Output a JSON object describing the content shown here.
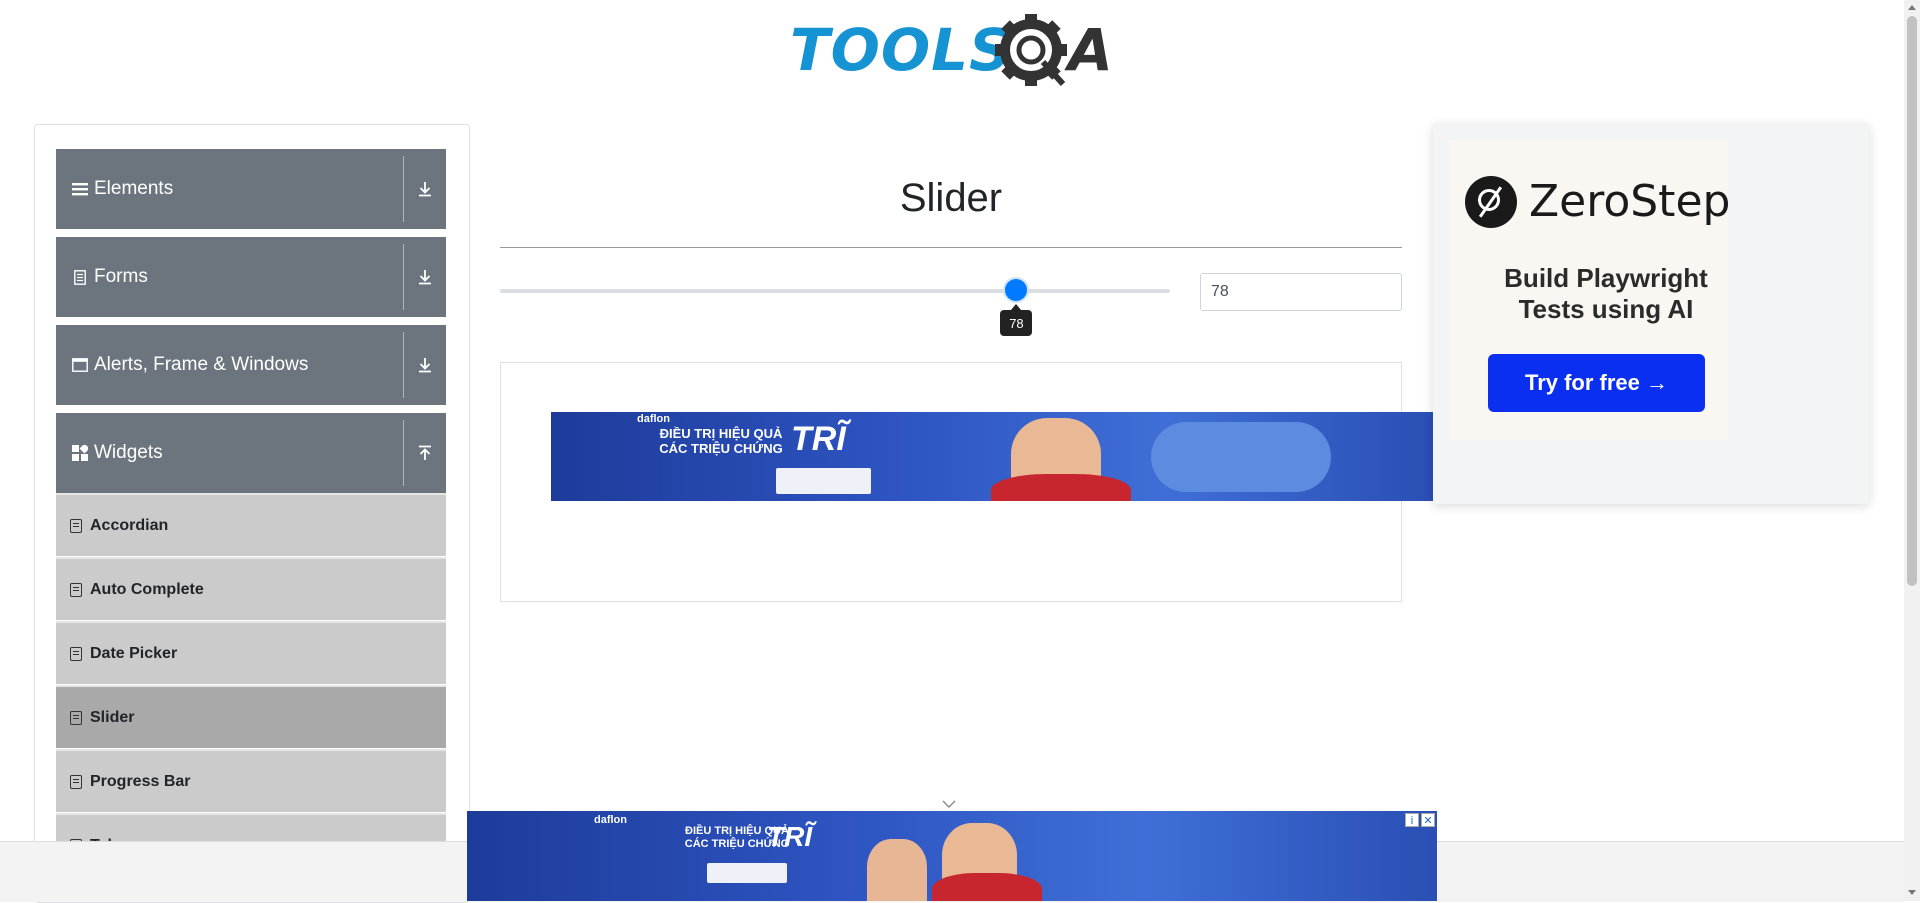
{
  "header": {
    "logo_text": "TOOLS",
    "logo_suffix": "A"
  },
  "sidebar": {
    "groups": [
      {
        "label": "Elements",
        "icon": "menu-bars-icon",
        "state": "collapsed"
      },
      {
        "label": "Forms",
        "icon": "document-icon",
        "state": "collapsed"
      },
      {
        "label": "Alerts, Frame & Windows",
        "icon": "window-icon",
        "state": "collapsed"
      },
      {
        "label": "Widgets",
        "icon": "widgets-icon",
        "state": "expanded"
      }
    ],
    "items": [
      {
        "label": "Accordian"
      },
      {
        "label": "Auto Complete"
      },
      {
        "label": "Date Picker"
      },
      {
        "label": "Slider",
        "active": true
      },
      {
        "label": "Progress Bar"
      },
      {
        "label": "Tabs"
      }
    ]
  },
  "main": {
    "title": "Slider",
    "slider": {
      "value": 78,
      "min": 0,
      "max": 100,
      "display": "78"
    },
    "value_field": "78"
  },
  "ads": {
    "banner_brand": "daflon",
    "banner_headline": "ĐIỀU TRỊ HIỆU QUẢ CÁC TRIỆU CHỨNG",
    "banner_big": "TRĨ",
    "right_ad": {
      "brand": "ZeroStep",
      "tagline": "Build Playwright Tests using AI",
      "button": "Try for free →"
    }
  },
  "colors": {
    "accent": "#007bff",
    "sidebar_header": "#6c757d",
    "sidebar_item": "#cbcbcb",
    "sidebar_item_active": "#a9a9a9",
    "logo_blue": "#1593d3",
    "zero_button": "#0a2ff0"
  }
}
